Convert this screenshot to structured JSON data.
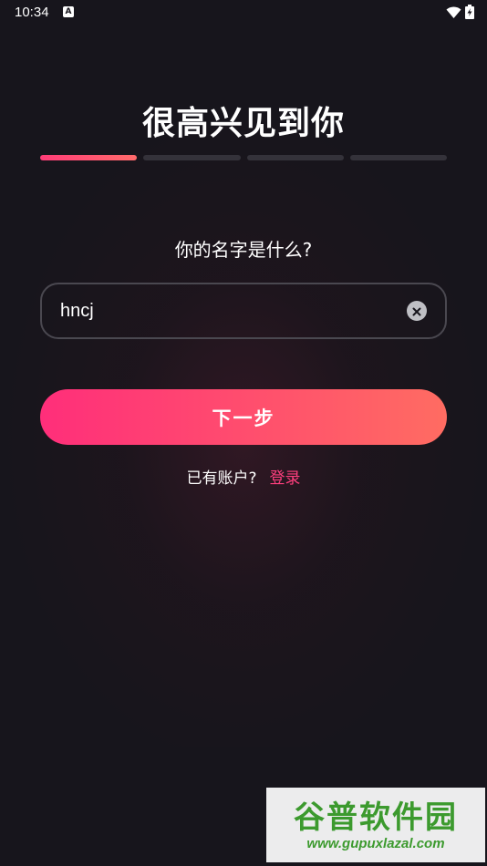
{
  "status_bar": {
    "time": "10:34",
    "notification_icon": "A",
    "icons": [
      "wifi-icon",
      "battery-charging-icon"
    ]
  },
  "page": {
    "title": "很高兴见到你",
    "progress": {
      "total_steps": 4,
      "current_step": 1
    },
    "question": "你的名字是什么?",
    "name_input": {
      "value": "hncj"
    },
    "next_button_label": "下一步",
    "has_account_text": "已有账户?",
    "login_link_label": "登录"
  },
  "watermark": {
    "name": "谷普软件园",
    "url": "www.gupuxlazal.com"
  },
  "colors": {
    "background": "#17151c",
    "accent_start": "#ff2e7a",
    "accent_end": "#ff6c62",
    "link": "#ff3f7e"
  }
}
